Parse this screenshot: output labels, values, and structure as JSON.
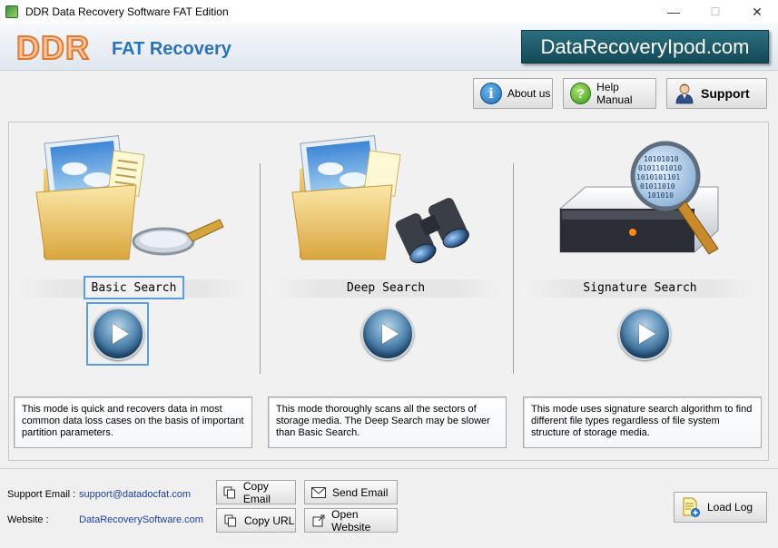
{
  "window": {
    "title": "DDR Data Recovery Software FAT Edition",
    "minimize": "—",
    "maximize": "☐",
    "close": "✕"
  },
  "banner": {
    "logo": "DDR",
    "product": "FAT Recovery",
    "website_badge": "DataRecoveryIpod.com"
  },
  "toolbar": {
    "about_label": "About us",
    "help_label": "Help Manual",
    "support_label": "Support",
    "about_icon": "info-icon",
    "help_icon": "question-icon",
    "support_icon": "user-icon"
  },
  "modes": [
    {
      "label": "Basic Search",
      "description": "This mode is quick and recovers data in most common data loss cases on the basis of important partition parameters.",
      "icon": "folder-magnifier-icon",
      "selected": true
    },
    {
      "label": "Deep Search",
      "description": "This mode thoroughly scans all the sectors of storage media. The Deep Search may be slower than Basic Search.",
      "icon": "folder-binoculars-icon",
      "selected": false
    },
    {
      "label": "Signature Search",
      "description": "This mode uses signature search algorithm to find different file types regardless of file system structure of storage media.",
      "icon": "drive-magnifier-icon",
      "selected": false
    }
  ],
  "footer": {
    "support_email_label": "Support Email :",
    "support_email": "support@datadocfat.com",
    "website_label": "Website :",
    "website": "DataRecoverySoftware.com",
    "copy_email": "Copy Email",
    "send_email": "Send Email",
    "copy_url": "Copy URL",
    "open_website": "Open Website",
    "load_log": "Load Log"
  },
  "colors": {
    "accent_blue": "#2a73b8",
    "badge_teal": "#134957",
    "logo_orange": "#e57828",
    "selection_blue": "#5a9ee0",
    "link_blue": "#1a3fa8"
  }
}
